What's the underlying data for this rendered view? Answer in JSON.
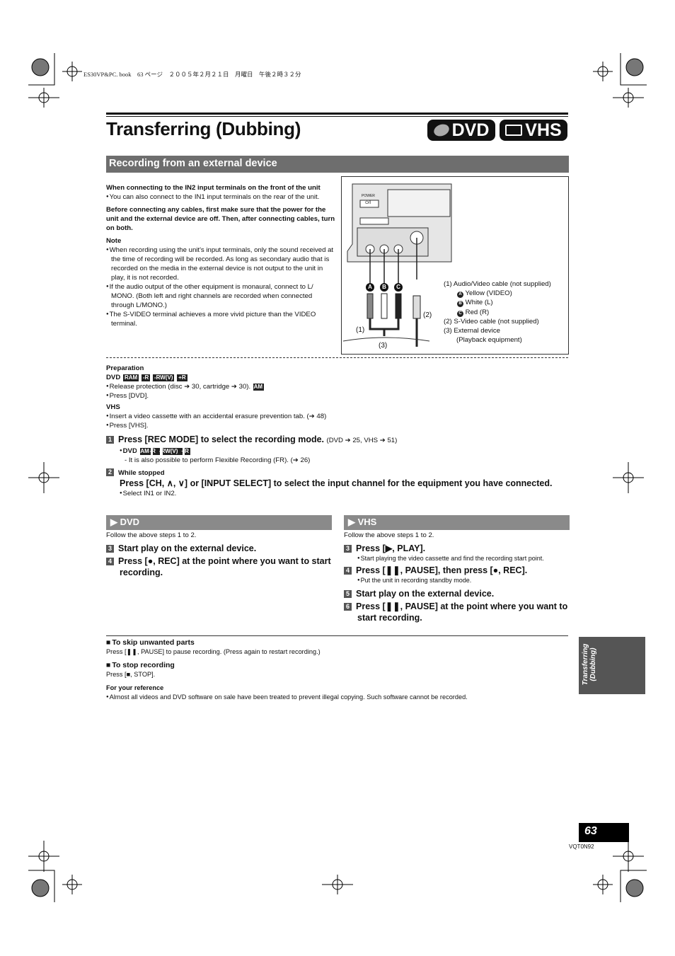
{
  "header": {
    "print_line": "ES30VP&PC. book　63 ページ　２００５年２月２１日　月曜日　午後２時３２分"
  },
  "title": "Transferring (Dubbing)",
  "badges": [
    {
      "label": "DVD",
      "icon": "disc-icon"
    },
    {
      "label": "VHS",
      "icon": "cassette-icon"
    }
  ],
  "section": "Recording from an external device",
  "intro": {
    "h1": "When connecting to the IN2 input terminals on the front of the unit",
    "b1": "You can also connect to the IN1 input terminals on the rear of the unit.",
    "h2": "Before connecting any cables, first make sure that the power for the unit and the external device are off. Then, after connecting cables, turn on both.",
    "note_label": "Note",
    "notes": [
      "When recording using the unit's input terminals, only the sound received at the time of recording will be recorded. As long as secondary audio that is recorded on the media in the external device is not output to the unit in play, it is not recorded.",
      "If the audio output of the other equipment is monaural, connect to L/ MONO. (Both left and right channels are recorded when connected through L/MONO.)",
      "The S-VIDEO terminal achieves a more vivid picture than the VIDEO terminal."
    ]
  },
  "diagram": {
    "power": "POWER",
    "power_btn": "⏻/I",
    "markers": [
      "A",
      "B",
      "C"
    ],
    "lbl1": "(1)",
    "lbl2": "(2)",
    "lbl3": "(3)",
    "legend": [
      "(1)  Audio/Video cable (not supplied)",
      "Yellow (VIDEO)",
      "White (L)",
      "Red (R)",
      "(2)  S-Video cable (not supplied)",
      "(3)  External device",
      "(Playback equipment)"
    ]
  },
  "prep": {
    "label": "Preparation",
    "dvd": "DVD",
    "tags": [
      "RAM",
      "-R",
      "-RW(V)",
      "+R"
    ],
    "dvd_items": [
      "Release protection (disc ➔ 30, cartridge ➔ 30).",
      "Press [DVD]."
    ],
    "vhs": "VHS",
    "vhs_items": [
      "Insert a video cassette with an accidental erasure prevention tab. (➔ 48)",
      "Press [VHS]."
    ]
  },
  "steps": {
    "s1": {
      "n": "1",
      "text": "Press [REC MODE] to select the recording mode.",
      "ref": "(DVD ➔ 25, VHS ➔ 51)",
      "sub": "DVD",
      "note": "- It is also possible to perform Flexible Recording (FR). (➔ 26)"
    },
    "s2": {
      "n": "2",
      "pre": "While stopped",
      "text": "Press [CH, ∧, ∨] or [INPUT SELECT] to select the input channel for the equipment you have connected.",
      "note": "Select IN1 or IN2."
    }
  },
  "dvd_col": {
    "bar": "DVD",
    "follow": "Follow the above steps 1 to 2.",
    "steps": [
      {
        "n": "3",
        "text": "Start play on the external device."
      },
      {
        "n": "4",
        "text": "Press [●, REC] at the point where you want to start recording."
      }
    ]
  },
  "vhs_col": {
    "bar": "VHS",
    "follow": "Follow the above steps 1 to 2.",
    "steps": [
      {
        "n": "3",
        "text": "Press [▶, PLAY].",
        "note": "Start playing the video cassette and find the recording start point."
      },
      {
        "n": "4",
        "text": "Press [❚❚, PAUSE], then press [●, REC].",
        "note": "Put the unit in recording standby mode."
      },
      {
        "n": "5",
        "text": "Start play on the external device."
      },
      {
        "n": "6",
        "text": "Press [❚❚, PAUSE] at the point where you want to start recording."
      }
    ]
  },
  "tips": {
    "skip_h": "To skip unwanted parts",
    "skip": "Press [❚❚, PAUSE] to pause recording. (Press again to restart recording.)",
    "stop_h": "To stop recording",
    "stop": "Press [■, STOP].",
    "ref_h": "For your reference",
    "ref": "Almost all videos and DVD software on sale have been treated to prevent illegal copying. Such software cannot be recorded."
  },
  "side_tab": {
    "line1": "Transferring",
    "line2": "(Dubbing)"
  },
  "page_number": "63",
  "code": "VQT0N92"
}
